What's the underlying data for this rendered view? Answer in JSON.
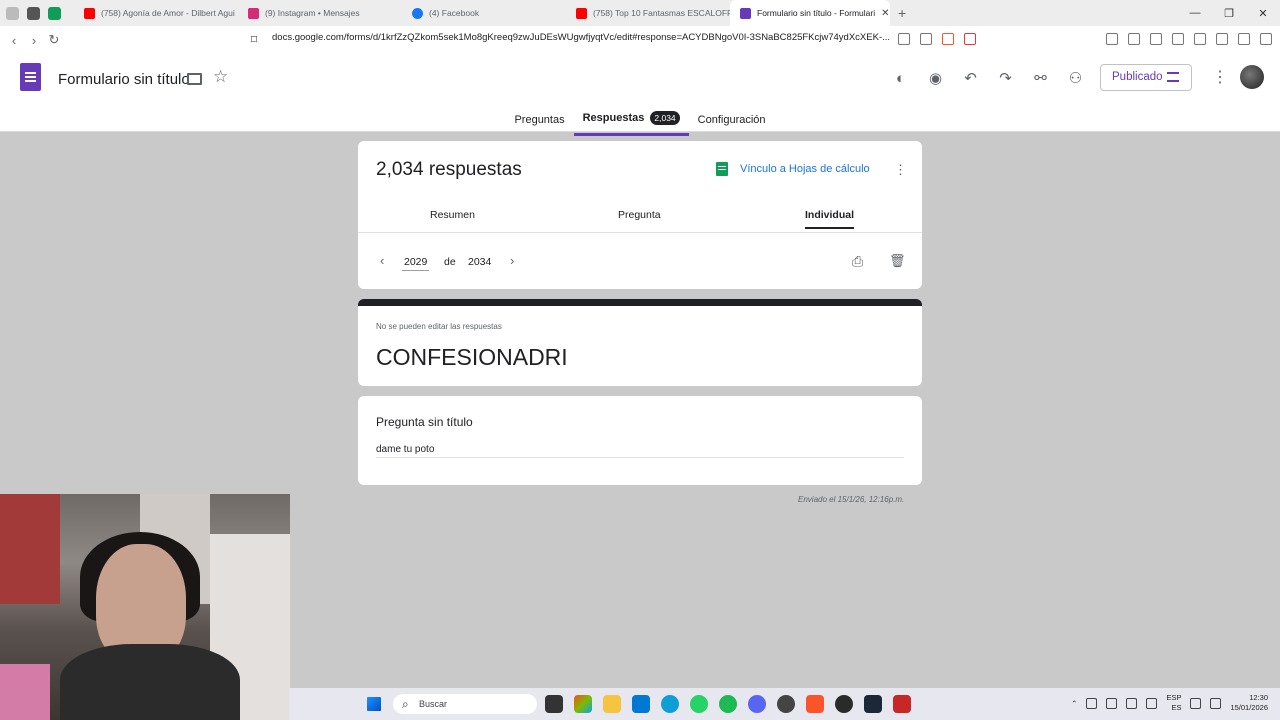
{
  "browser": {
    "tabs": [
      {
        "title": "(758) Agonía de Amor - Dilbert Agui",
        "color": "#ff0000"
      },
      {
        "title": "(9) Instagram • Mensajes",
        "color": "#d62976"
      },
      {
        "title": "(4) Facebook",
        "color": "#1877f2"
      },
      {
        "title": "(758) Top 10 Fantasmas ESCALOFRIA",
        "color": "#ff0000"
      },
      {
        "title": "Formulario sin título - Formulari",
        "color": "#673ab7",
        "active": true
      }
    ],
    "url": "docs.google.com/forms/d/1krfZzQZkom5sek1Mo8gKreeq9zwJuDEsWUgwfjyqtVc/edit#response=ACYDBNgoV0I-3SNaBC825FKcjw74ydXcXEK-..."
  },
  "header": {
    "form_title": "Formulario sin título",
    "publish_label": "Publicado",
    "tabs": {
      "questions": "Preguntas",
      "responses": "Respuestas",
      "responses_count": "2,034",
      "settings": "Configuración"
    }
  },
  "summary": {
    "count_label": "2,034 respuestas",
    "sheets_link": "Vínculo a Hojas de cálculo",
    "subtabs": {
      "summary": "Resumen",
      "question": "Pregunta",
      "individual": "Individual"
    },
    "pager": {
      "current": "2029",
      "of": "de",
      "total": "2034"
    }
  },
  "response": {
    "notice": "No se pueden editar las respuestas",
    "title": "CONFESIONADRI",
    "question_title": "Pregunta sin título",
    "answer": "dame tu poto",
    "sent": "Enviado el 15/1/26, 12:16p.m."
  },
  "taskbar": {
    "search_placeholder": "Buscar",
    "lang": "ESP",
    "lang_sub": "ES",
    "time": "12:30",
    "date": "15/01/2026"
  }
}
